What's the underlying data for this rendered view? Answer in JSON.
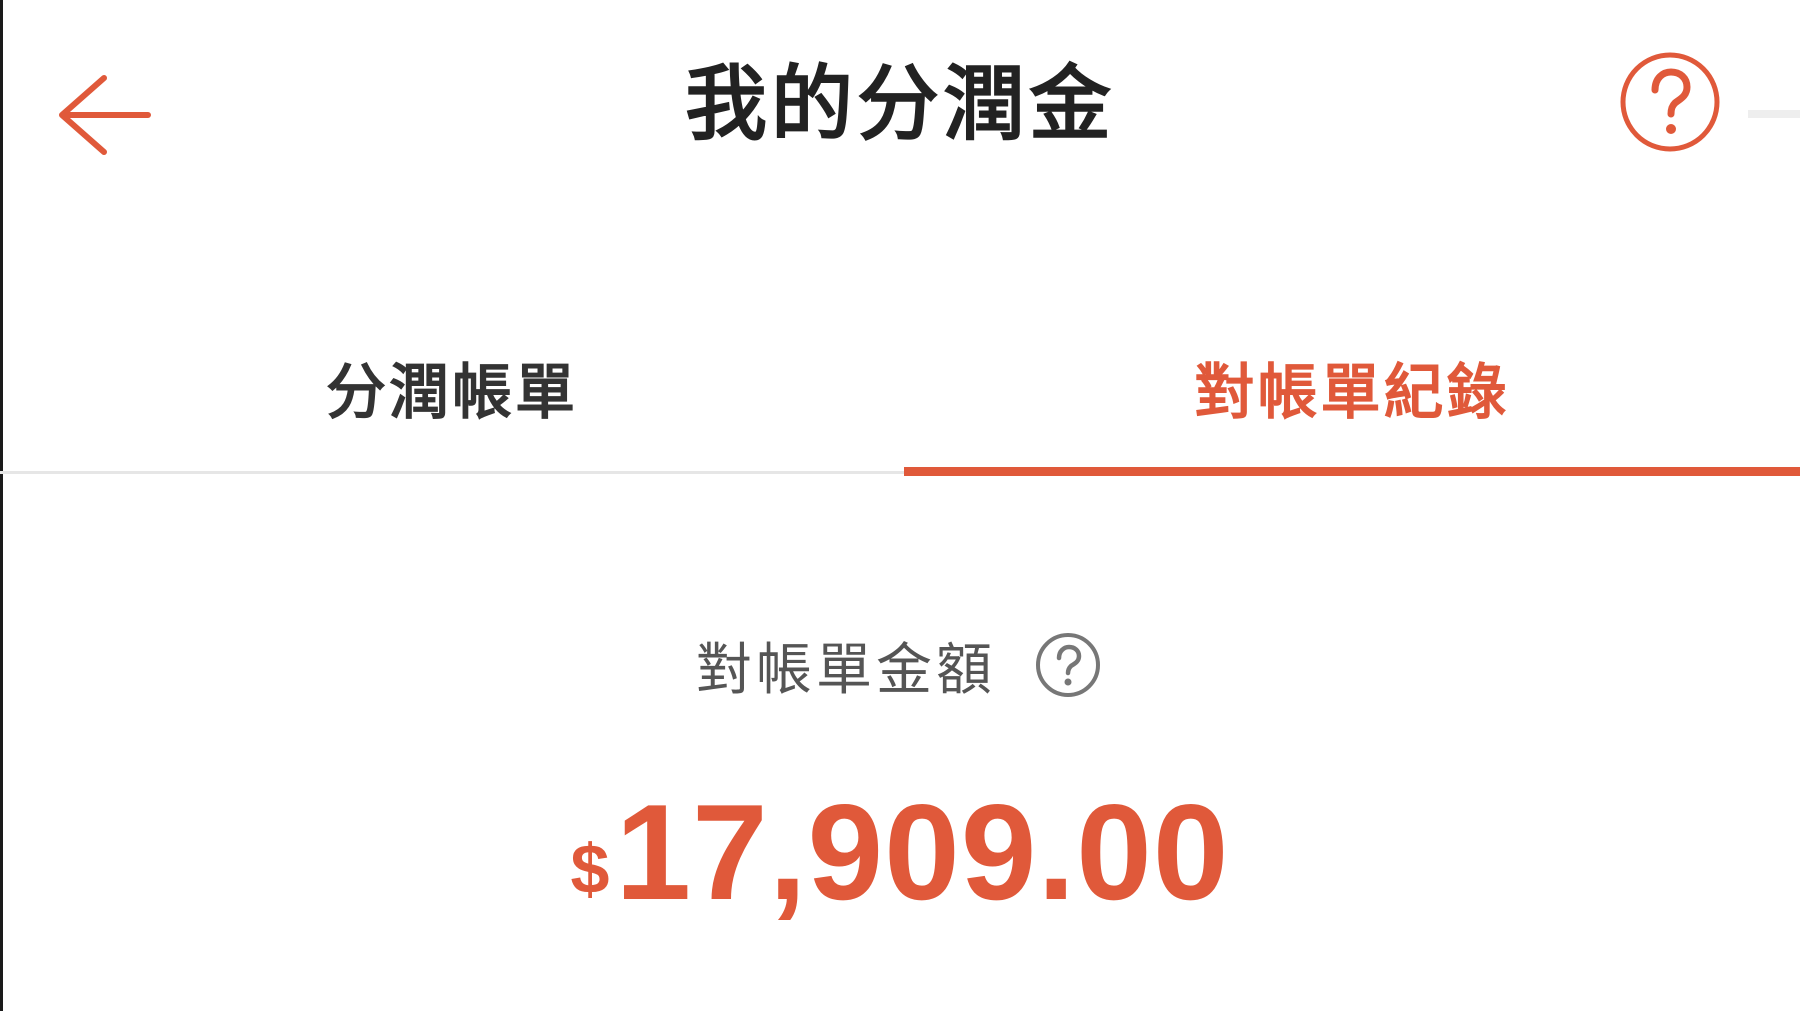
{
  "colors": {
    "accent": "#e0593a",
    "title_text": "#222222",
    "inactive_tab_text": "#333333",
    "label_text": "#555555",
    "divider": "#e6e6e6",
    "background": "#ffffff"
  },
  "header": {
    "title": "我的分潤金",
    "back_icon": "arrow-left-icon",
    "help_icon": "question-circle-icon"
  },
  "tabs": [
    {
      "label": "分潤帳單",
      "active": false
    },
    {
      "label": "對帳單紀錄",
      "active": true
    }
  ],
  "summary": {
    "label": "對帳單金額",
    "help_icon": "question-circle-icon",
    "currency_symbol": "$",
    "amount": "17,909.00"
  }
}
